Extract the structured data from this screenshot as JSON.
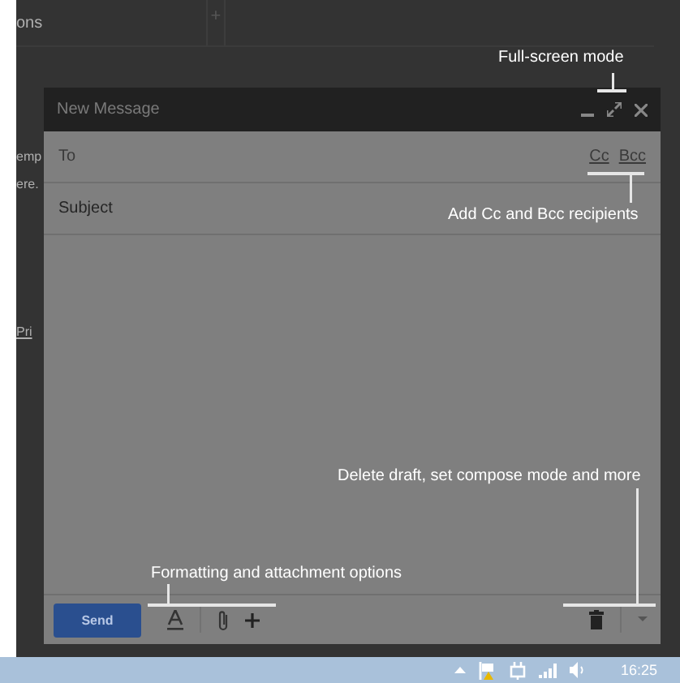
{
  "background": {
    "tab_label": "ons",
    "tab_add": "+",
    "text_fragments": [
      "emp",
      "ere.",
      "Pri"
    ]
  },
  "compose": {
    "title": "New Message",
    "to_label": "To",
    "cc": "Cc",
    "bcc": "Bcc",
    "subject_placeholder": "Subject",
    "send": "Send"
  },
  "callouts": [
    {
      "text": "Full-screen mode"
    },
    {
      "text": "Add Cc and Bcc recipients"
    },
    {
      "text": "Delete draft, set compose mode and more"
    },
    {
      "text": "Formatting and attachment options"
    }
  ],
  "taskbar": {
    "time": "16:25"
  }
}
